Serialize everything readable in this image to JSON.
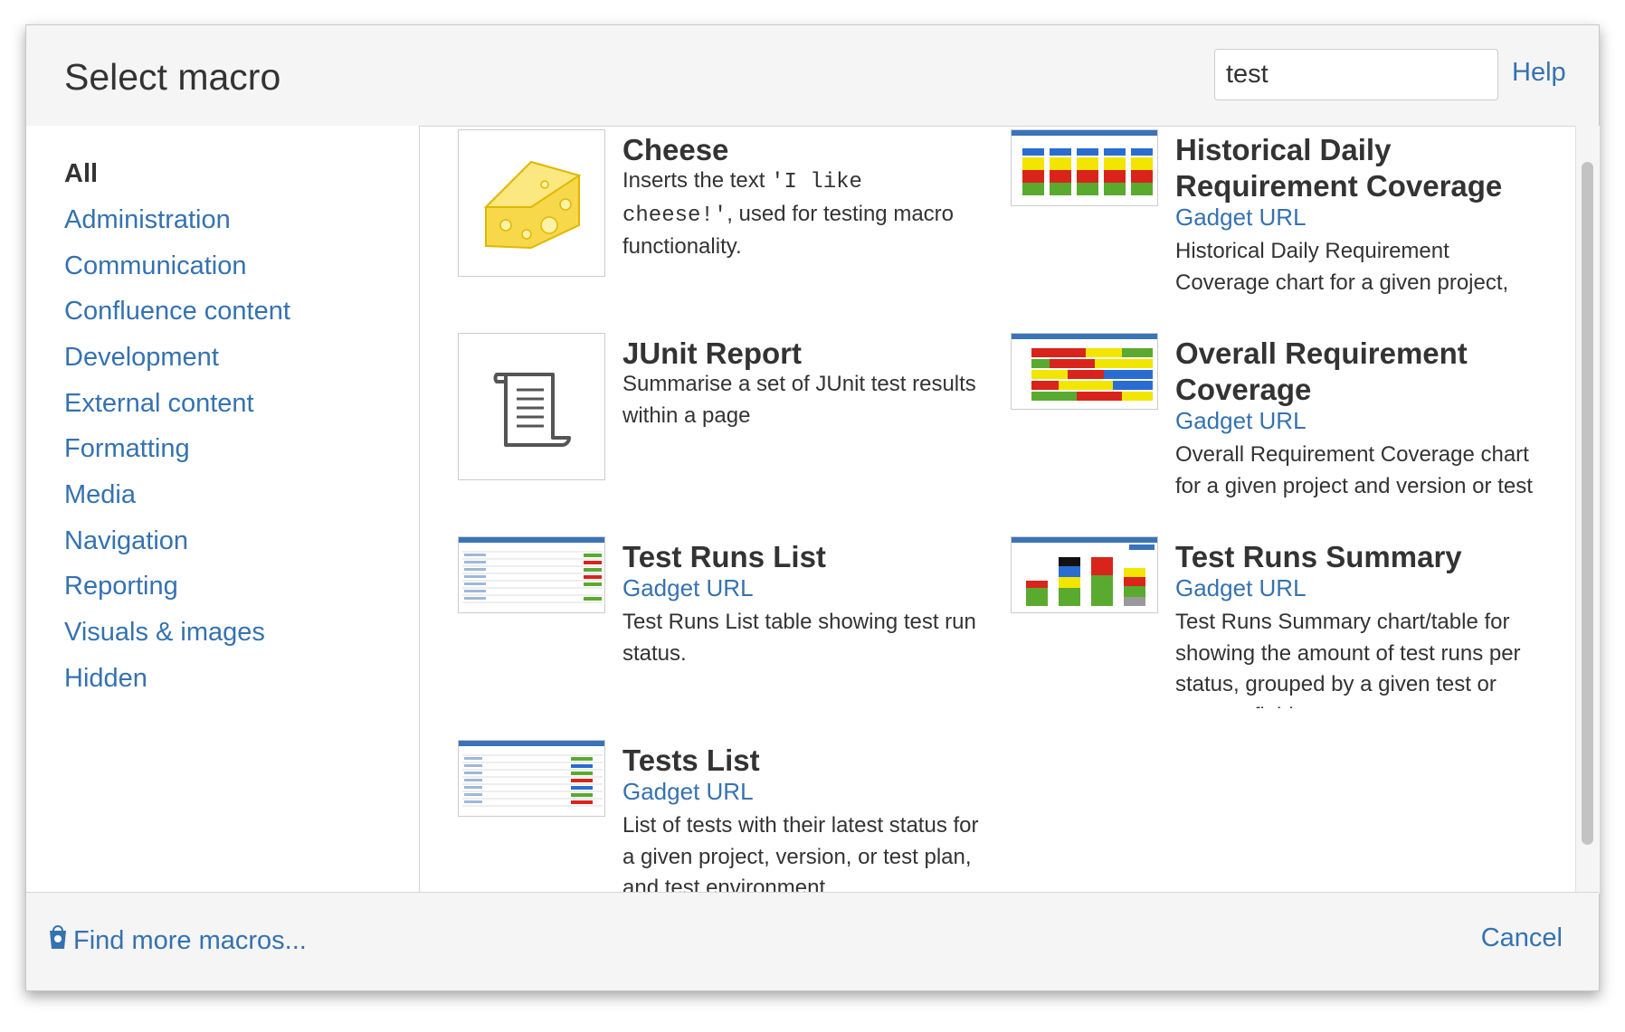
{
  "dialog": {
    "title": "Select macro"
  },
  "search": {
    "value": "test",
    "placeholder": ""
  },
  "header": {
    "help_label": "Help"
  },
  "sidebar": {
    "categories": [
      {
        "label": "All",
        "active": true
      },
      {
        "label": "Administration"
      },
      {
        "label": "Communication"
      },
      {
        "label": "Confluence content"
      },
      {
        "label": "Development"
      },
      {
        "label": "External content"
      },
      {
        "label": "Formatting"
      },
      {
        "label": "Media"
      },
      {
        "label": "Navigation"
      },
      {
        "label": "Reporting"
      },
      {
        "label": "Visuals & images"
      },
      {
        "label": "Hidden"
      }
    ]
  },
  "macros": [
    {
      "name": "Cheese",
      "link": "",
      "desc_prefix": "Inserts the text ",
      "desc_code": "'I like cheese!'",
      "desc_suffix": ", used for testing macro functionality.",
      "icon": "cheese-icon"
    },
    {
      "name": "Historical Daily Requirement Coverage",
      "link": "Gadget URL",
      "desc": "Historical Daily Requirement Coverage chart for a given project, version or test plan and period",
      "icon": "chart-thumbnail"
    },
    {
      "name": "JUnit Report",
      "link": "",
      "desc": "Summarise a set of JUnit test results within a page",
      "icon": "scroll-icon"
    },
    {
      "name": "Overall Requirement Coverage",
      "link": "Gadget URL",
      "desc": "Overall Requirement Coverage chart for a given project and version or test plan",
      "icon": "chart-thumbnail"
    },
    {
      "name": "Test Runs List",
      "link": "Gadget URL",
      "desc": "Test Runs List table showing test run status.",
      "icon": "table-thumbnail"
    },
    {
      "name": "Test Runs Summary",
      "link": "Gadget URL",
      "desc": "Test Runs Summary chart/table for showing the amount of test runs per status, grouped by a given test or test run field.",
      "icon": "bar-chart-thumbnail"
    },
    {
      "name": "Tests List",
      "link": "Gadget URL",
      "desc": "List of tests with their latest status for a given project, version, or test plan, and test environment.",
      "icon": "table-thumbnail"
    }
  ],
  "footer": {
    "find_more_label": "Find more macros...",
    "cancel_label": "Cancel"
  },
  "colors": {
    "link": "#3572b0",
    "text": "#333333",
    "header_bg": "#f5f5f5",
    "cheese": "#f7d84a"
  }
}
